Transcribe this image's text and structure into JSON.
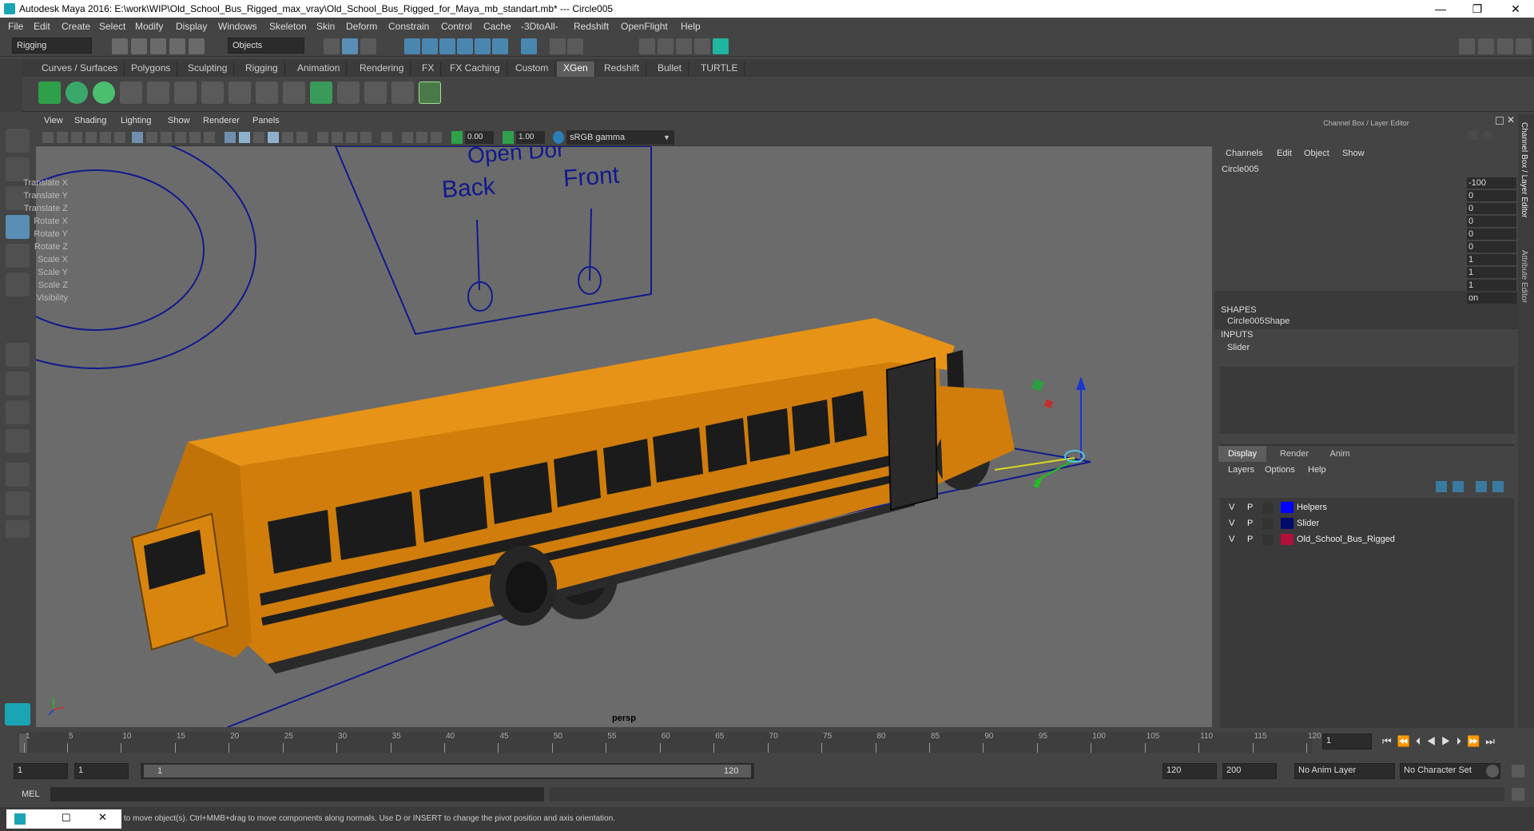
{
  "title_bar": {
    "title": "Autodesk Maya 2016: E:\\work\\WIP\\Old_School_Bus_Rigged_max_vray\\Old_School_Bus_Rigged_for_Maya_mb_standart.mb*  ---  Circle005",
    "minimize": "—",
    "maximize": "❐",
    "close": "✕"
  },
  "menubar": [
    "File",
    "Edit",
    "Create",
    "Select",
    "Modify",
    "Display",
    "Windows",
    "Skeleton",
    "Skin",
    "Deform",
    "Constrain",
    "Control",
    "Cache",
    "-3DtoAll-",
    "Redshift",
    "OpenFlight",
    "Help"
  ],
  "status_line": {
    "mode": "Rigging",
    "selection_mode": "Objects"
  },
  "shelf_tabs": [
    "Curves / Surfaces",
    "Polygons",
    "Sculpting",
    "Rigging",
    "Animation",
    "Rendering",
    "FX",
    "FX Caching",
    "Custom",
    "XGen",
    "Redshift",
    "Bullet",
    "TURTLE"
  ],
  "active_shelf_tab": "XGen",
  "viewport": {
    "menus": [
      "View",
      "Shading",
      "Lighting",
      "Show",
      "Renderer",
      "Panels"
    ],
    "exposure": "0.00",
    "gamma": "1.00",
    "color_space": "sRGB gamma",
    "camera_label": "persp",
    "scene_text": {
      "open_dor": "Open Dor",
      "back": "Back",
      "front": "Front"
    }
  },
  "channel_box": {
    "header": "Channel Box / Layer Editor",
    "menus": [
      "Channels",
      "Edit",
      "Object",
      "Show"
    ],
    "object_name": "Circle005",
    "attributes": [
      {
        "label": "Translate X",
        "value": "-100"
      },
      {
        "label": "Translate Y",
        "value": "0"
      },
      {
        "label": "Translate Z",
        "value": "0"
      },
      {
        "label": "Rotate X",
        "value": "0"
      },
      {
        "label": "Rotate Y",
        "value": "0"
      },
      {
        "label": "Rotate Z",
        "value": "0"
      },
      {
        "label": "Scale X",
        "value": "1"
      },
      {
        "label": "Scale Y",
        "value": "1"
      },
      {
        "label": "Scale Z",
        "value": "1"
      },
      {
        "label": "Visibility",
        "value": "on"
      }
    ],
    "shapes_heading": "SHAPES",
    "shape": "Circle005Shape",
    "inputs_heading": "INPUTS",
    "input": "Slider"
  },
  "layer_editor": {
    "tabs": [
      "Display",
      "Render",
      "Anim"
    ],
    "active_tab": "Display",
    "menus": [
      "Layers",
      "Options",
      "Help"
    ],
    "layers": [
      {
        "v": "V",
        "p": "P",
        "name": "Helpers",
        "color": "#0000ff"
      },
      {
        "v": "V",
        "p": "P",
        "name": "Slider",
        "color": "#000a6a"
      },
      {
        "v": "V",
        "p": "P",
        "name": "Old_School_Bus_Rigged",
        "color": "#b0103a"
      }
    ]
  },
  "side_tabs": [
    "Channel Box / Layer Editor",
    "Attribute Editor"
  ],
  "timeline": {
    "ticks": [
      "1",
      "5",
      "10",
      "15",
      "20",
      "25",
      "30",
      "35",
      "40",
      "45",
      "50",
      "55",
      "60",
      "65",
      "70",
      "75",
      "80",
      "85",
      "90",
      "95",
      "100",
      "105",
      "110",
      "115",
      "120"
    ],
    "current_frame": "1"
  },
  "range_slider": {
    "start": "1",
    "playback_start": "1",
    "slider_start": "1",
    "slider_end": "120",
    "playback_end": "120",
    "end": "200",
    "anim_layer": "No Anim Layer",
    "character_set": "No Character Set"
  },
  "command_line": {
    "label": "MEL"
  },
  "help_line": {
    "text": "to move object(s). Ctrl+MMB+drag to move components along normals. Use D or INSERT to change the pivot position and axis orientation."
  },
  "colors": {
    "bus_body": "#e08a10",
    "viewport_bg": "#6b6b6b",
    "wire_blue": "#101a8c",
    "active_tab": "#5d5d5d"
  }
}
